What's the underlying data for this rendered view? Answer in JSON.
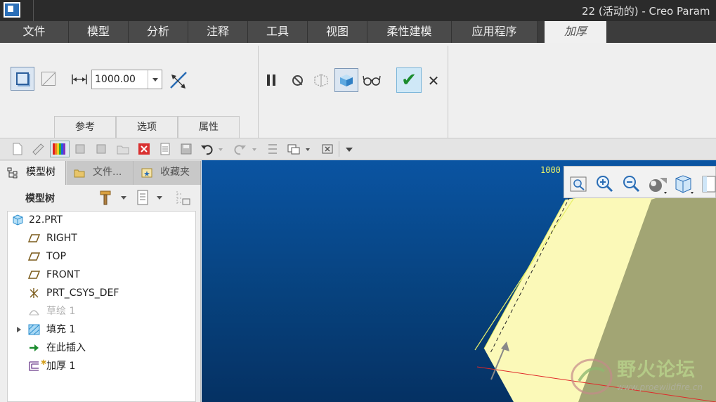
{
  "window": {
    "title": "22 (活动的) - Creo Param"
  },
  "ribbon_tabs": [
    "文件",
    "模型",
    "分析",
    "注释",
    "工具",
    "视图",
    "柔性建模",
    "应用程序",
    "加厚"
  ],
  "dashboard": {
    "thickness_value": "1000.00",
    "subtabs": [
      "参考",
      "选项",
      "属性"
    ]
  },
  "panel": {
    "tabs": [
      "模型树",
      "文件...",
      "收藏夹"
    ],
    "tree_title": "模型树"
  },
  "model_tree": [
    {
      "label": "22.PRT",
      "icon": "part-icon",
      "dim": false
    },
    {
      "label": "RIGHT",
      "icon": "datum-plane-icon",
      "dim": false
    },
    {
      "label": "TOP",
      "icon": "datum-plane-icon",
      "dim": false
    },
    {
      "label": "FRONT",
      "icon": "datum-plane-icon",
      "dim": false
    },
    {
      "label": "PRT_CSYS_DEF",
      "icon": "csys-icon",
      "dim": false
    },
    {
      "label": "草绘 1",
      "icon": "sketch-icon",
      "dim": true
    },
    {
      "label": "填充 1",
      "icon": "fill-icon",
      "dim": false
    },
    {
      "label": "在此插入",
      "icon": "insert-here-arrow-icon",
      "dim": false
    },
    {
      "label": "加厚 1",
      "icon": "thicken-icon",
      "dim": false
    }
  ],
  "viewport": {
    "dimension_label": "1000",
    "watermark": {
      "title": "野火论坛",
      "url": "www.proewildfire.cn"
    }
  },
  "colors": {
    "viewport_top": "#0a54a2",
    "viewport_bottom": "#053163",
    "surface_light": "#fbf9b8",
    "surface_olive": "#a2a574",
    "accept_green": "#1b8c2e"
  }
}
